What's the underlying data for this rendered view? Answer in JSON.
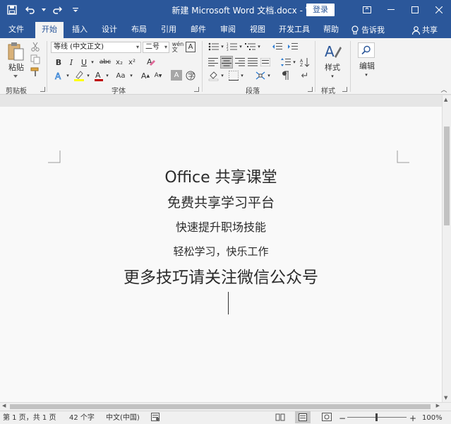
{
  "titlebar": {
    "title": "新建 Microsoft Word 文档.docx - Word",
    "login": "登录",
    "qat_icons": [
      "save-icon",
      "undo-icon",
      "redo-icon",
      "customize-qat-icon"
    ],
    "window_buttons": [
      "ribbon-display-options-icon",
      "minimize-icon",
      "maximize-icon",
      "close-icon"
    ]
  },
  "tabs": [
    {
      "label": "文件"
    },
    {
      "label": "开始"
    },
    {
      "label": "插入"
    },
    {
      "label": "设计"
    },
    {
      "label": "布局"
    },
    {
      "label": "引用"
    },
    {
      "label": "邮件"
    },
    {
      "label": "审阅"
    },
    {
      "label": "视图"
    },
    {
      "label": "开发工具"
    },
    {
      "label": "帮助"
    }
  ],
  "active_tab": "开始",
  "tell_me": "告诉我",
  "share": "共享",
  "ribbon": {
    "clipboard": {
      "paste_label": "粘贴",
      "group_label": "剪贴板"
    },
    "font": {
      "font_name": "等线 (中文正文)",
      "font_size": "二号",
      "group_label": "字体",
      "buttons": [
        "B",
        "I",
        "U",
        "abc",
        "x₂",
        "x²"
      ]
    },
    "paragraph": {
      "group_label": "段落"
    },
    "styles": {
      "label": "样式",
      "group_label": "样式"
    },
    "editing": {
      "label": "编辑"
    }
  },
  "document": {
    "lines": [
      "Office 共享课堂",
      "免费共享学习平台",
      "快速提升职场技能",
      "轻松学习，快乐工作",
      "更多技巧请关注微信公众号"
    ]
  },
  "statusbar": {
    "page": "第 1 页，共 1 页",
    "words": "42 个字",
    "language": "中文(中国)",
    "zoom": "100%",
    "zoom_minus": "−",
    "zoom_plus": "+"
  },
  "colors": {
    "brand_blue": "#2b579a",
    "ribbon_bg": "#f3f3f3",
    "highlight_yellow": "#ffff00",
    "font_color_red": "#c00000"
  }
}
